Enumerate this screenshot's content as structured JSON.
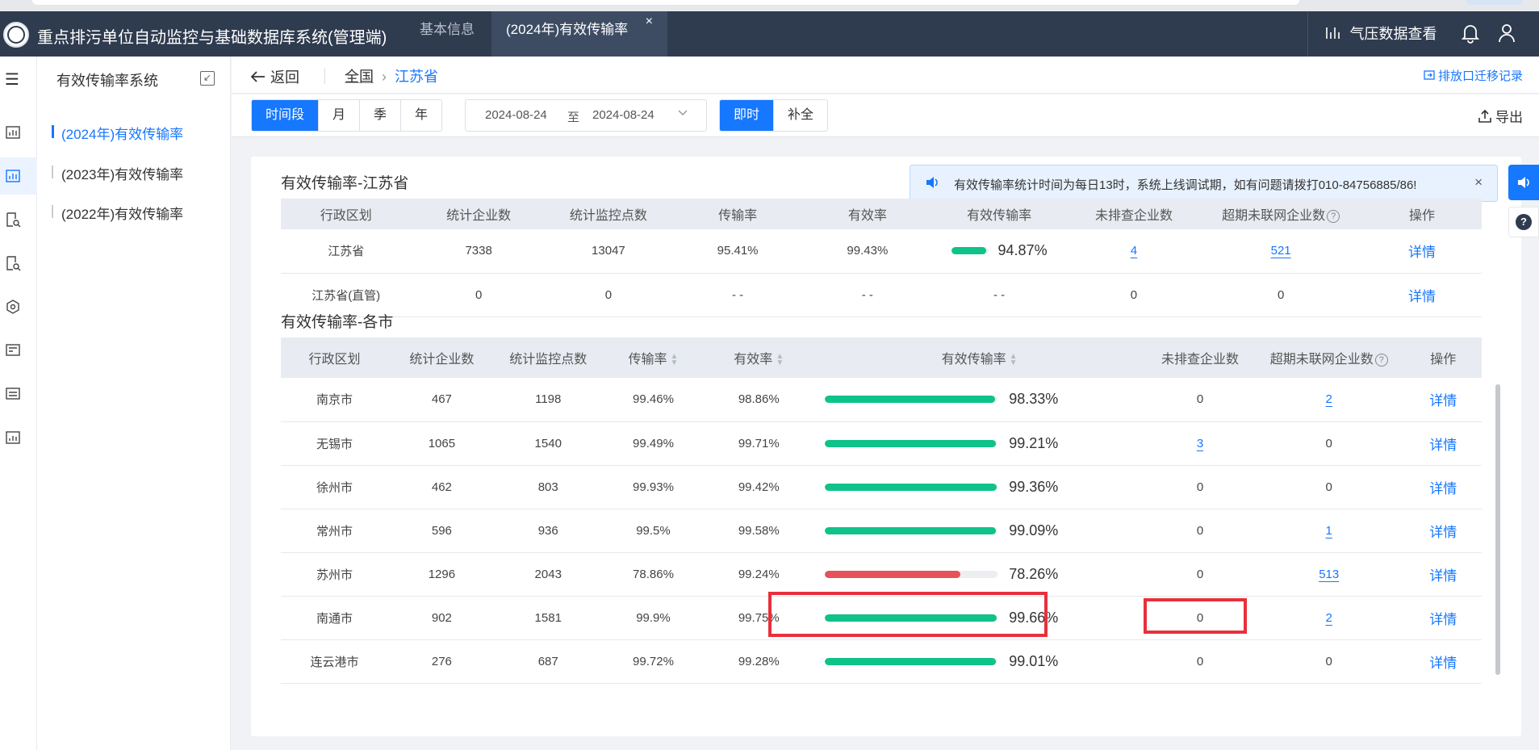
{
  "app": {
    "title": "重点排污单位自动监控与基础数据库系统(管理端)",
    "tabs": [
      {
        "label": "基本信息"
      },
      {
        "label": "(2024年)有效传输率"
      }
    ],
    "close_glyph": "×",
    "pressure_label": "气压数据查看"
  },
  "sidebar": {
    "title": "有效传输率系统",
    "items": [
      {
        "label": "(2024年)有效传输率"
      },
      {
        "label": "(2023年)有效传输率"
      },
      {
        "label": "(2022年)有效传输率"
      }
    ]
  },
  "crumbs": {
    "back": "返回",
    "root": "全国",
    "current": "江苏省",
    "migrate": "排放口迁移记录"
  },
  "filters": {
    "periods": [
      "时间段",
      "月",
      "季",
      "年"
    ],
    "date_start": "2024-08-24",
    "date_sep": "至",
    "date_end": "2024-08-24",
    "modes": [
      "即时",
      "补全"
    ],
    "export": "导出"
  },
  "notice": {
    "text": "有效传输率统计时间为每日13时，系统上线调试期，如有问题请拨打010-84756885/86!"
  },
  "province": {
    "title": "有效传输率-江苏省",
    "headers": [
      "行政区划",
      "统计企业数",
      "统计监控点数",
      "传输率",
      "有效率",
      "有效传输率",
      "未排查企业数",
      "超期未联网企业数",
      "操作"
    ],
    "rows": [
      {
        "region": "江苏省",
        "ent": "7338",
        "pts": "13047",
        "trans": "95.41%",
        "valid": "99.43%",
        "eff": "94.87%",
        "eff_value": 94.87,
        "unchecked": "4",
        "overdue": "521",
        "op": "详情"
      },
      {
        "region": "江苏省(直管)",
        "ent": "0",
        "pts": "0",
        "trans": "- -",
        "valid": "- -",
        "eff": "- -",
        "unchecked": "0",
        "overdue": "0",
        "op": "详情"
      }
    ]
  },
  "cities": {
    "title": "有效传输率-各市",
    "headers": [
      "行政区划",
      "统计企业数",
      "统计监控点数",
      "传输率",
      "有效率",
      "有效传输率",
      "未排查企业数",
      "超期未联网企业数",
      "操作"
    ],
    "rows": [
      {
        "region": "南京市",
        "ent": "467",
        "pts": "1198",
        "trans": "99.46%",
        "valid": "98.86%",
        "eff": "98.33%",
        "eff_value": 98.33,
        "unchecked": "0",
        "overdue": "2",
        "op": "详情"
      },
      {
        "region": "无锡市",
        "ent": "1065",
        "pts": "1540",
        "trans": "99.49%",
        "valid": "99.71%",
        "eff": "99.21%",
        "eff_value": 99.21,
        "unchecked": "3",
        "overdue": "0",
        "op": "详情"
      },
      {
        "region": "徐州市",
        "ent": "462",
        "pts": "803",
        "trans": "99.93%",
        "valid": "99.42%",
        "eff": "99.36%",
        "eff_value": 99.36,
        "unchecked": "0",
        "overdue": "0",
        "op": "详情"
      },
      {
        "region": "常州市",
        "ent": "596",
        "pts": "936",
        "trans": "99.5%",
        "valid": "99.58%",
        "eff": "99.09%",
        "eff_value": 99.09,
        "unchecked": "0",
        "overdue": "1",
        "op": "详情"
      },
      {
        "region": "苏州市",
        "ent": "1296",
        "pts": "2043",
        "trans": "78.86%",
        "valid": "99.24%",
        "eff": "78.26%",
        "eff_value": 78.26,
        "unchecked": "0",
        "overdue": "513",
        "op": "详情"
      },
      {
        "region": "南通市",
        "ent": "902",
        "pts": "1581",
        "trans": "99.9%",
        "valid": "99.75%",
        "eff": "99.66%",
        "eff_value": 99.66,
        "unchecked": "0",
        "overdue": "2",
        "op": "详情"
      },
      {
        "region": "连云港市",
        "ent": "276",
        "pts": "687",
        "trans": "99.72%",
        "valid": "99.28%",
        "eff": "99.01%",
        "eff_value": 99.01,
        "unchecked": "0",
        "overdue": "0",
        "op": "详情"
      }
    ]
  },
  "colors": {
    "accent": "#1677ff",
    "topbar": "#2f3b4f",
    "bar_good": "#0fc28a",
    "bar_bad": "#e5525a",
    "highlight": "#e8303b"
  },
  "icons": [
    "menu-icon",
    "chart-icon",
    "search-doc-icon",
    "settings-icon",
    "bell-icon",
    "user-icon",
    "speaker-icon",
    "help-icon",
    "export-icon",
    "back-arrow-icon"
  ]
}
